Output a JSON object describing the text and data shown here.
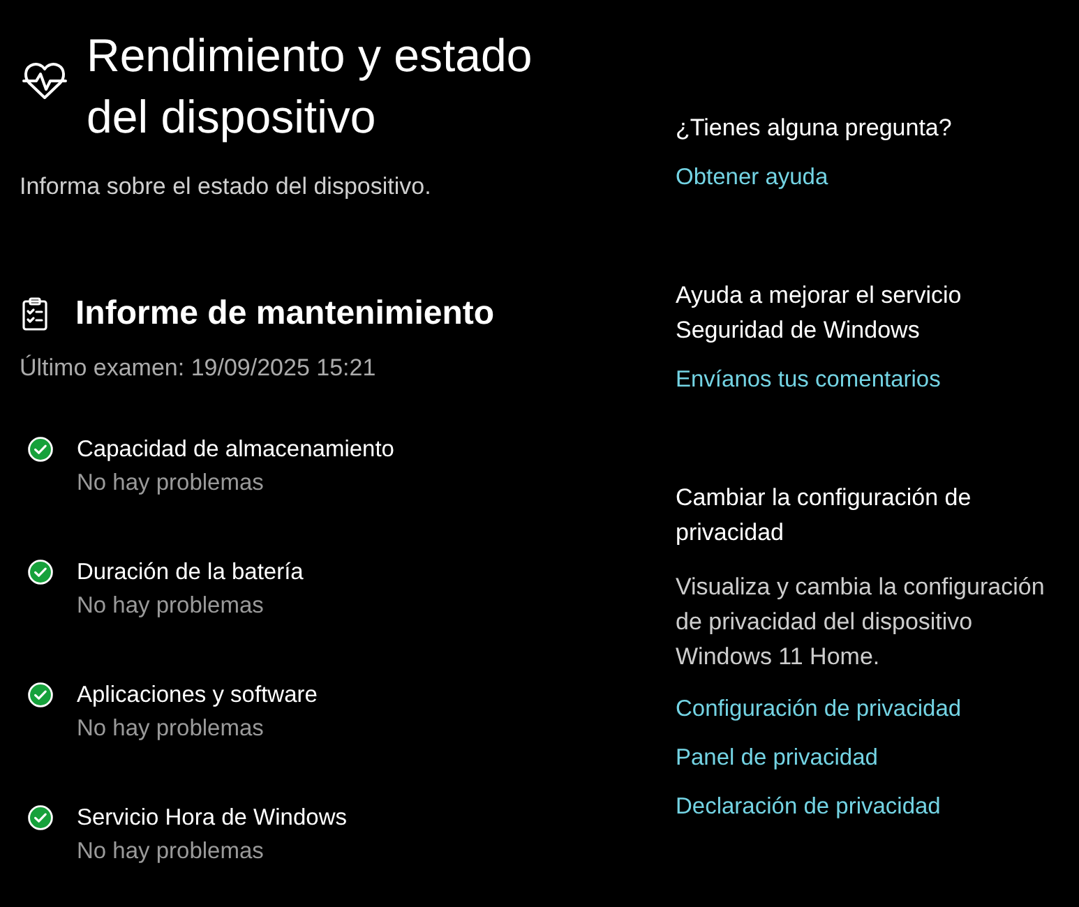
{
  "header": {
    "title": "Rendimiento y estado del dispositivo",
    "description": "Informa sobre el estado del dispositivo."
  },
  "report": {
    "title": "Informe de mantenimiento",
    "last_scan": "Último examen: 19/09/2025 15:21",
    "items": [
      {
        "name": "Capacidad de almacenamiento",
        "status": "No hay problemas"
      },
      {
        "name": "Duración de la batería",
        "status": "No hay problemas"
      },
      {
        "name": "Aplicaciones y software",
        "status": "No hay problemas"
      },
      {
        "name": "Servicio Hora de Windows",
        "status": "No hay problemas"
      }
    ]
  },
  "sidebar": {
    "sections": [
      {
        "heading": "¿Tienes alguna pregunta?",
        "links": [
          "Obtener ayuda"
        ]
      },
      {
        "heading": "Ayuda a mejorar el servicio Seguridad de Windows",
        "links": [
          "Envíanos tus comentarios"
        ]
      },
      {
        "heading": "Cambiar la configuración de privacidad",
        "description": "Visualiza y cambia la configuración de privacidad del dispositivo Windows 11 Home.",
        "links": [
          "Configuración de privacidad",
          "Panel de privacidad",
          "Declaración de privacidad"
        ]
      }
    ]
  }
}
